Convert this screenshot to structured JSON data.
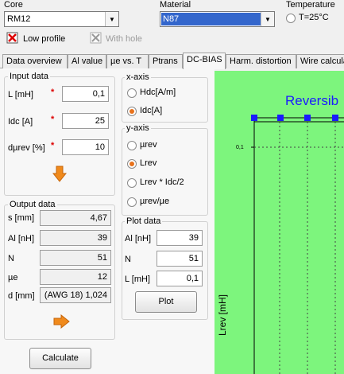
{
  "top": {
    "core_label": "Core",
    "core_value": "RM12",
    "material_label": "Material",
    "material_value": "N87",
    "temperature_label": "Temperature",
    "temperature_option": "T=25°C",
    "low_profile_label": "Low profile",
    "with_hole_label": "With hole"
  },
  "tabs": [
    "Data overview",
    "Al value",
    "µe vs. T",
    "Ptrans",
    "DC-BIAS",
    "Harm. distortion",
    "Wire calcula"
  ],
  "active_tab": "DC-BIAS",
  "input": {
    "title": "Input data",
    "l_label": "L [mH]",
    "l_value": "0,1",
    "idc_label": "Idc [A]",
    "idc_value": "25",
    "dmu_label": "dµrev [%]",
    "dmu_value": "10",
    "required_mark": "*"
  },
  "output": {
    "title": "Output data",
    "s_label": "s [mm]",
    "s_value": "4,67",
    "al_label": "Al [nH]",
    "al_value": "39",
    "n_label": "N",
    "n_value": "51",
    "mue_label": "µe",
    "mue_value": "12",
    "d_label": "d [mm]",
    "d_value": "(AWG 18) 1,024"
  },
  "calculate_label": "Calculate",
  "xaxis": {
    "title": "x-axis",
    "opt1": "Hdc[A/m]",
    "opt2": "Idc[A]",
    "selected": "Idc[A]"
  },
  "yaxis": {
    "title": "y-axis",
    "opt1": "µrev",
    "opt2": "Lrev",
    "opt3": "Lrev * Idc/2",
    "opt4": "µrev/µe",
    "selected": "Lrev"
  },
  "plotdata": {
    "title": "Plot data",
    "al_label": "Al [nH]",
    "al_value": "39",
    "n_label": "N",
    "n_value": "51",
    "l_label": "L [mH]",
    "l_value": "0,1"
  },
  "plot_button": "Plot",
  "chart": {
    "title": "Reversib",
    "ylabel": "Lrev [mH]",
    "ytick": "0,1"
  },
  "colors": {
    "plot_bg": "#7df57d",
    "title_blue": "#1a1aff",
    "radio_accent": "#e8721c",
    "arrow_orange": "#f08a1c",
    "required_red": "#dd0000"
  }
}
